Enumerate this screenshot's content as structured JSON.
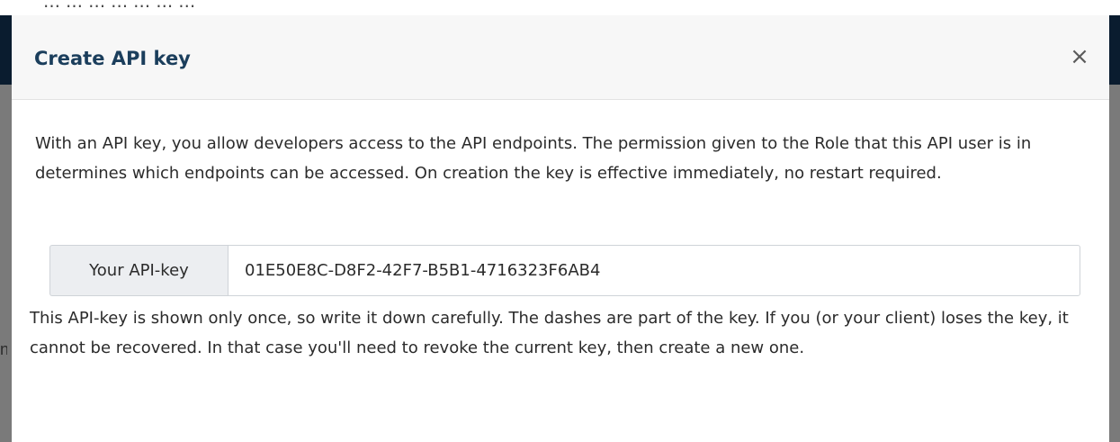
{
  "modal": {
    "title": "Create API key",
    "close_label": "×",
    "description": "With an API key, you allow developers access to the API endpoints. The permission given to the Role that this API user is in determines which endpoints can be accessed. On creation the key is effective immediately, no restart required.",
    "api_key_label": "Your API-key",
    "api_key_value": "01E50E8C-D8F2-42F7-B5B1-4716323F6AB4",
    "warning": "This API-key is shown only once, so write it down carefully. The dashes are part of the key. If you (or your client) loses the key, it cannot be recovered. In that case you'll need to revoke the current key, then create a new one."
  },
  "background": {
    "top_strip_text": "… … … … … … …",
    "left_edge_text": "na"
  },
  "colors": {
    "title": "#1b3e5c",
    "navbar": "#0a1c2f",
    "overlay": "#7a7a7a",
    "header_bg": "#f7f7f7",
    "addon_bg": "#eceef1"
  }
}
